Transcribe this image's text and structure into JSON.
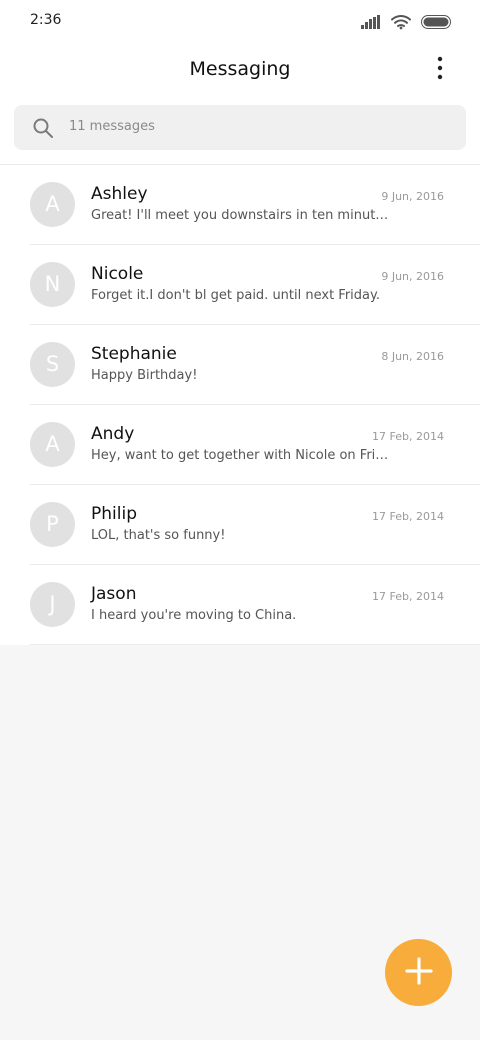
{
  "status_bar": {
    "time": "2:36",
    "icons": [
      "signal-icon",
      "wifi-icon",
      "battery-icon"
    ]
  },
  "header": {
    "title": "Messaging",
    "menu_icon": "more-vertical-icon"
  },
  "search": {
    "placeholder": "11 messages",
    "icon": "search-icon"
  },
  "messages": [
    {
      "initial": "A",
      "name": "Ashley",
      "date": "9 Jun, 2016",
      "preview": "Great! I'll meet you downstairs in ten minutes. Don't be late!"
    },
    {
      "initial": "N",
      "name": "Nicole",
      "date": "9 Jun, 2016",
      "preview": "Forget it.I don't bl get paid. until next Friday."
    },
    {
      "initial": "S",
      "name": "Stephanie",
      "date": "8 Jun, 2016",
      "preview": "Happy Birthday!"
    },
    {
      "initial": "A",
      "name": "Andy",
      "date": "17 Feb, 2014",
      "preview": "Hey, want to get together with Nicole on Friday?"
    },
    {
      "initial": "P",
      "name": "Philip",
      "date": "17 Feb, 2014",
      "preview": "LOL, that's so funny!"
    },
    {
      "initial": "J",
      "name": "Jason",
      "date": "17 Feb, 2014",
      "preview": "I heard you're moving to China."
    }
  ],
  "fab": {
    "icon": "plus-icon"
  },
  "colors": {
    "accent": "#f8ac3c",
    "avatar_bg": "#e1e1e1",
    "search_bg": "#f0f0f0",
    "page_bg": "#f6f6f6"
  }
}
